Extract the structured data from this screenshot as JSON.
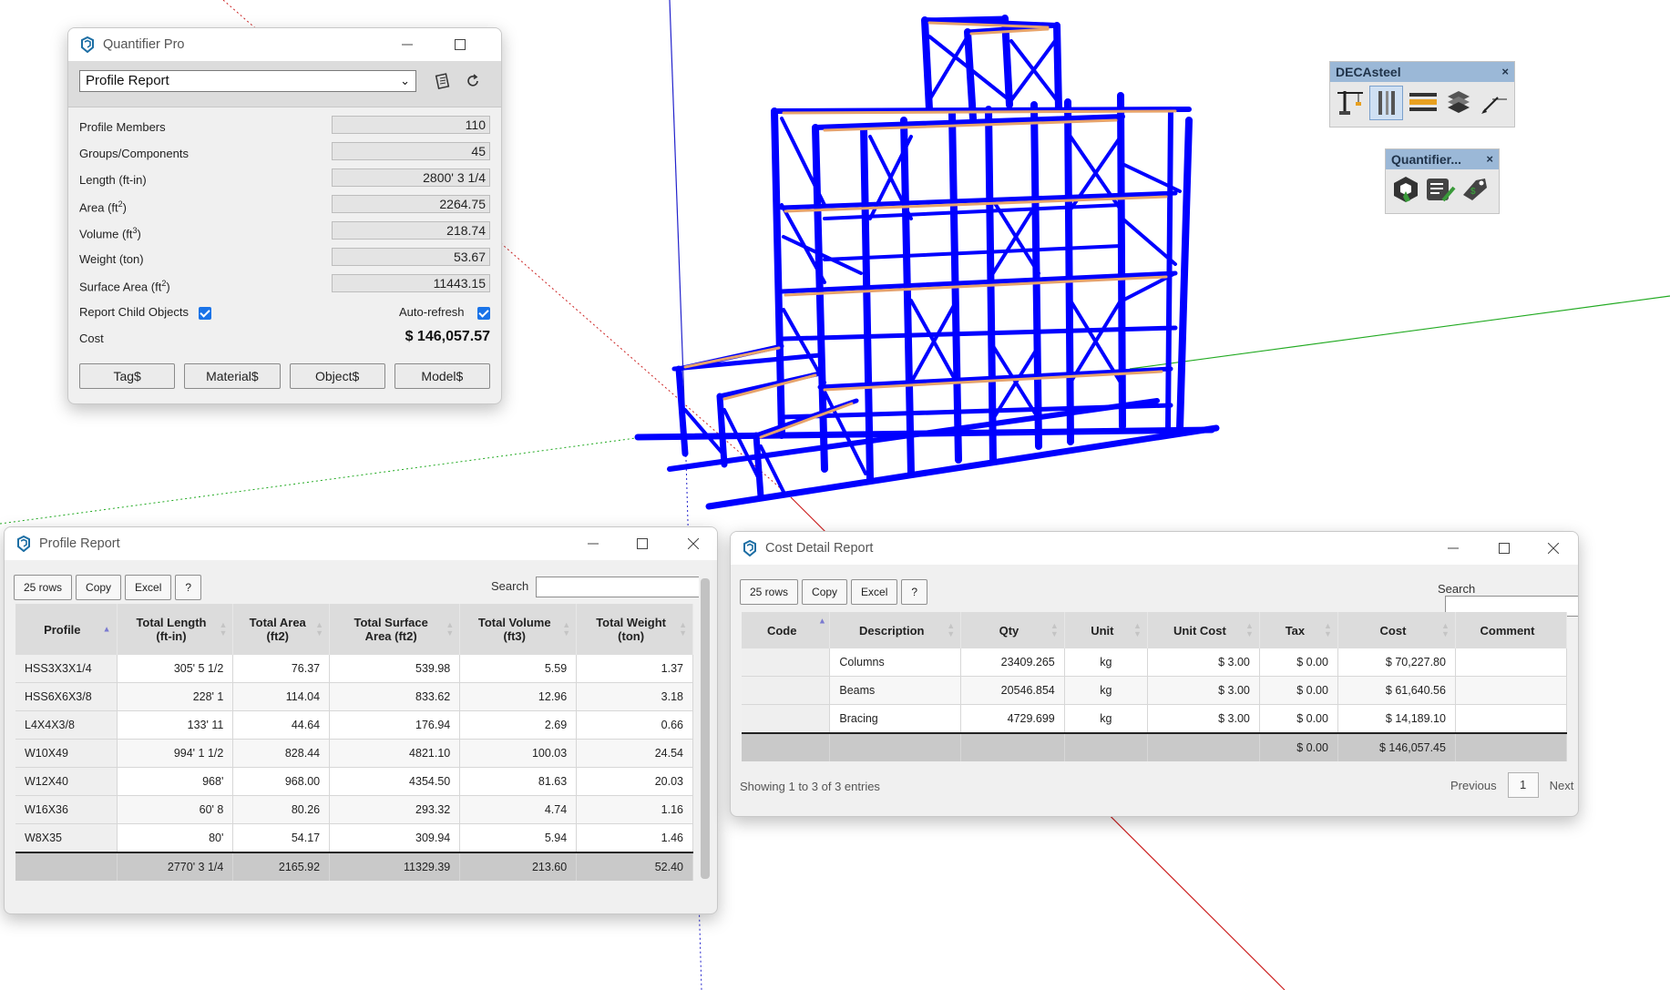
{
  "colors": {
    "steel": "#0000ff",
    "beam_highlight": "#e7a36b",
    "axis_red": "#cc2222",
    "axis_green": "#22aa22",
    "axis_blue": "#2222cc"
  },
  "quantifier": {
    "title": "Quantifier Pro",
    "report_select": "Profile Report",
    "icons": [
      "clipboard-icon",
      "refresh-icon"
    ],
    "rows": [
      {
        "label": "Profile Members",
        "value": "110"
      },
      {
        "label": "Groups/Components",
        "value": "45"
      },
      {
        "label": "Length (ft-in)",
        "value": "2800' 3 1/4"
      },
      {
        "label": "Area (ft",
        "sup": "2",
        "tail": ")",
        "value": "2264.75"
      },
      {
        "label": "Volume (ft",
        "sup": "3",
        "tail": ")",
        "value": "218.74"
      },
      {
        "label": "Weight (ton)",
        "value": "53.67"
      },
      {
        "label": "Surface Area (ft",
        "sup": "2",
        "tail": ")",
        "value": "11443.15"
      }
    ],
    "report_child_label": "Report Child Objects",
    "auto_refresh_label": "Auto-refresh",
    "cost_label": "Cost",
    "cost_value": "$ 146,057.57",
    "buttons": [
      "Tag$",
      "Material$",
      "Object$",
      "Model$"
    ]
  },
  "decasteel": {
    "title": "DECAsteel",
    "close": "×",
    "icons": [
      "tower-crane-icon",
      "column-section-icon",
      "beam-icon",
      "layered-profile-icon",
      "dimension-tool-icon"
    ]
  },
  "quantifier_toolbar": {
    "title": "Quantifier...",
    "close": "×",
    "icons": [
      "quantifier-logo-icon",
      "report-edit-icon",
      "price-tag-icon"
    ]
  },
  "profile_report": {
    "title": "Profile Report",
    "buttons": [
      "25 rows",
      "Copy",
      "Excel",
      "?"
    ],
    "search_label": "Search",
    "headers": [
      {
        "a": "Profile",
        "b": ""
      },
      {
        "a": "Total Length",
        "b": "(ft-in)"
      },
      {
        "a": "Total Area",
        "b": "(ft2)"
      },
      {
        "a": "Total Surface",
        "b": "Area (ft2)"
      },
      {
        "a": "Total Volume",
        "b": "(ft3)"
      },
      {
        "a": "Total Weight",
        "b": "(ton)"
      }
    ],
    "rows": [
      [
        "HSS3X3X1/4",
        "305' 5 1/2",
        "76.37",
        "539.98",
        "5.59",
        "1.37"
      ],
      [
        "HSS6X6X3/8",
        "228' 1",
        "114.04",
        "833.62",
        "12.96",
        "3.18"
      ],
      [
        "L4X4X3/8",
        "133' 11",
        "44.64",
        "176.94",
        "2.69",
        "0.66"
      ],
      [
        "W10X49",
        "994' 1 1/2",
        "828.44",
        "4821.10",
        "100.03",
        "24.54"
      ],
      [
        "W12X40",
        "968'",
        "968.00",
        "4354.50",
        "81.63",
        "20.03"
      ],
      [
        "W16X36",
        "60' 8",
        "80.26",
        "293.32",
        "4.74",
        "1.16"
      ],
      [
        "W8X35",
        "80'",
        "54.17",
        "309.94",
        "5.94",
        "1.46"
      ]
    ],
    "totals": [
      "",
      "2770' 3 1/4",
      "2165.92",
      "11329.39",
      "213.60",
      "52.40"
    ]
  },
  "cost_report": {
    "title": "Cost Detail Report",
    "buttons": [
      "25 rows",
      "Copy",
      "Excel",
      "?"
    ],
    "search_label": "Search",
    "headers": [
      "Code",
      "Description",
      "Qty",
      "Unit",
      "Unit Cost",
      "Tax",
      "Cost",
      "Comment"
    ],
    "rows": [
      [
        "",
        "Columns",
        "23409.265",
        "kg",
        "$ 3.00",
        "$ 0.00",
        "$ 70,227.80",
        ""
      ],
      [
        "",
        "Beams",
        "20546.854",
        "kg",
        "$ 3.00",
        "$ 0.00",
        "$ 61,640.56",
        ""
      ],
      [
        "",
        "Bracing",
        "4729.699",
        "kg",
        "$ 3.00",
        "$ 0.00",
        "$ 14,189.10",
        ""
      ]
    ],
    "totals": [
      "",
      "",
      "",
      "",
      "",
      "$ 0.00",
      "$ 146,057.45",
      ""
    ],
    "showing": "Showing 1 to 3 of 3 entries",
    "prev": "Previous",
    "page": "1",
    "next": "Next"
  }
}
